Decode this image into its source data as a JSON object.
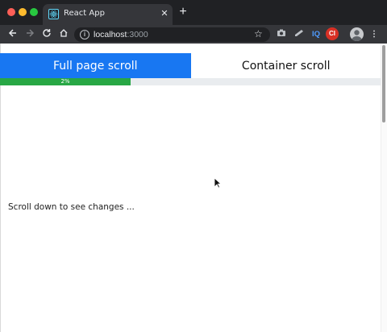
{
  "browser": {
    "tab_title": "React App",
    "url_host": "localhost",
    "url_port": ":3000",
    "extensions": {
      "iq_label": "IQ",
      "ci_label": "CI"
    }
  },
  "app": {
    "tabs": [
      {
        "label": "Full page scroll",
        "active": true
      },
      {
        "label": "Container scroll",
        "active": false
      }
    ],
    "progress": {
      "percent": 2,
      "label": "2%"
    },
    "hint": "Scroll down to see changes ..."
  },
  "icons": {
    "favicon": "react-logo-icon",
    "back": "arrow-left-icon",
    "forward": "arrow-right-icon",
    "reload": "reload-icon",
    "home": "home-icon",
    "info": "info-icon",
    "bookmark": "star-icon",
    "camera": "camera-icon",
    "sketch": "sketch-icon",
    "menu": "kebab-menu-icon",
    "cursor": "mouse-pointer-icon"
  },
  "colors": {
    "active_tab": "#1877f2",
    "progress_fill": "#28a745",
    "progress_track": "#e9ecef"
  }
}
